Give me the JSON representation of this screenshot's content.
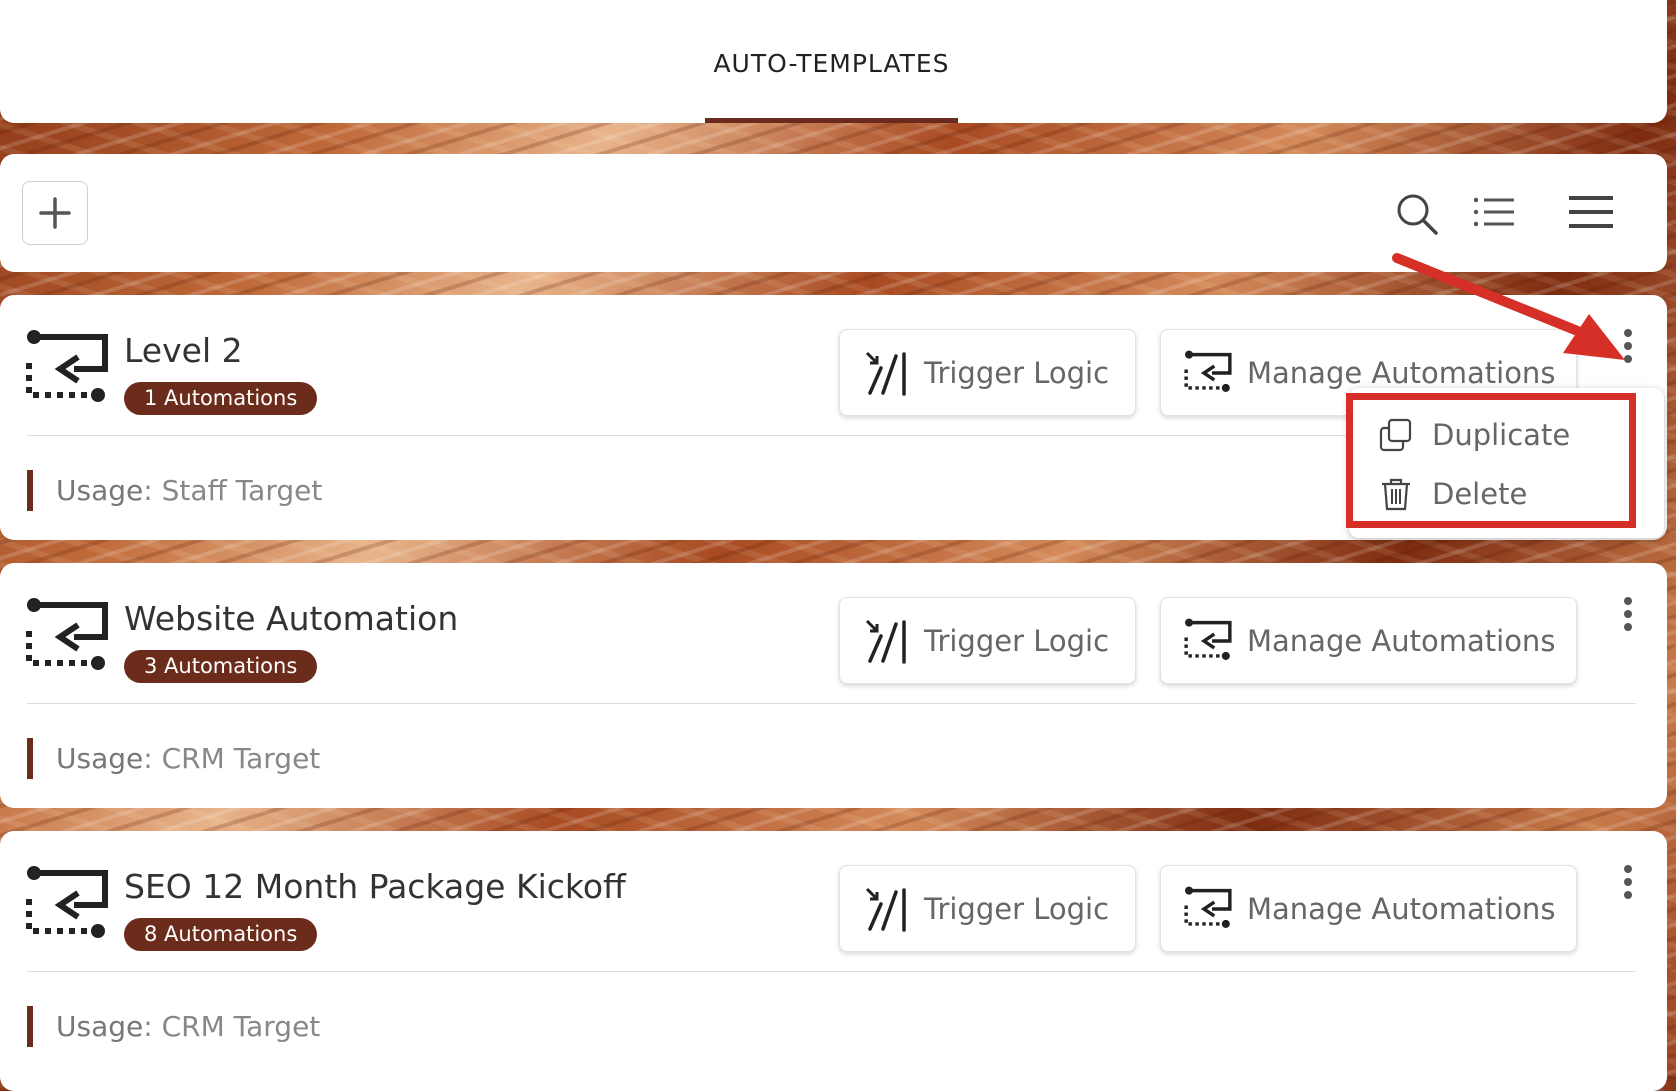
{
  "tabs": {
    "active_label": "AUTO-TEMPLATES",
    "accent_color": "#6a2a1c"
  },
  "toolbar": {
    "add_icon": "plus-icon",
    "search_icon": "search-icon",
    "list_view_icon": "list-icon",
    "menu_icon": "menu-icon"
  },
  "templates": [
    {
      "title": "Level 2",
      "badge": "1 Automations",
      "trigger_label": "Trigger Logic",
      "manage_label": "Manage Automations",
      "usage_key": "Usage",
      "usage_value": ": Staff Target"
    },
    {
      "title": "Website Automation",
      "badge": "3 Automations",
      "trigger_label": "Trigger Logic",
      "manage_label": "Manage Automations",
      "usage_key": "Usage",
      "usage_value": ": CRM Target"
    },
    {
      "title": "SEO 12 Month Package Kickoff",
      "badge": "8 Automations",
      "trigger_label": "Trigger Logic",
      "manage_label": "Manage Automations",
      "usage_key": "Usage",
      "usage_value": ": CRM Target"
    }
  ],
  "dropdown": {
    "items": [
      {
        "label": "Duplicate",
        "icon": "duplicate-icon"
      },
      {
        "label": "Delete",
        "icon": "trash-icon"
      }
    ]
  },
  "colors": {
    "badge_bg": "#6b2c1b",
    "annotation_red": "#d62f28"
  }
}
